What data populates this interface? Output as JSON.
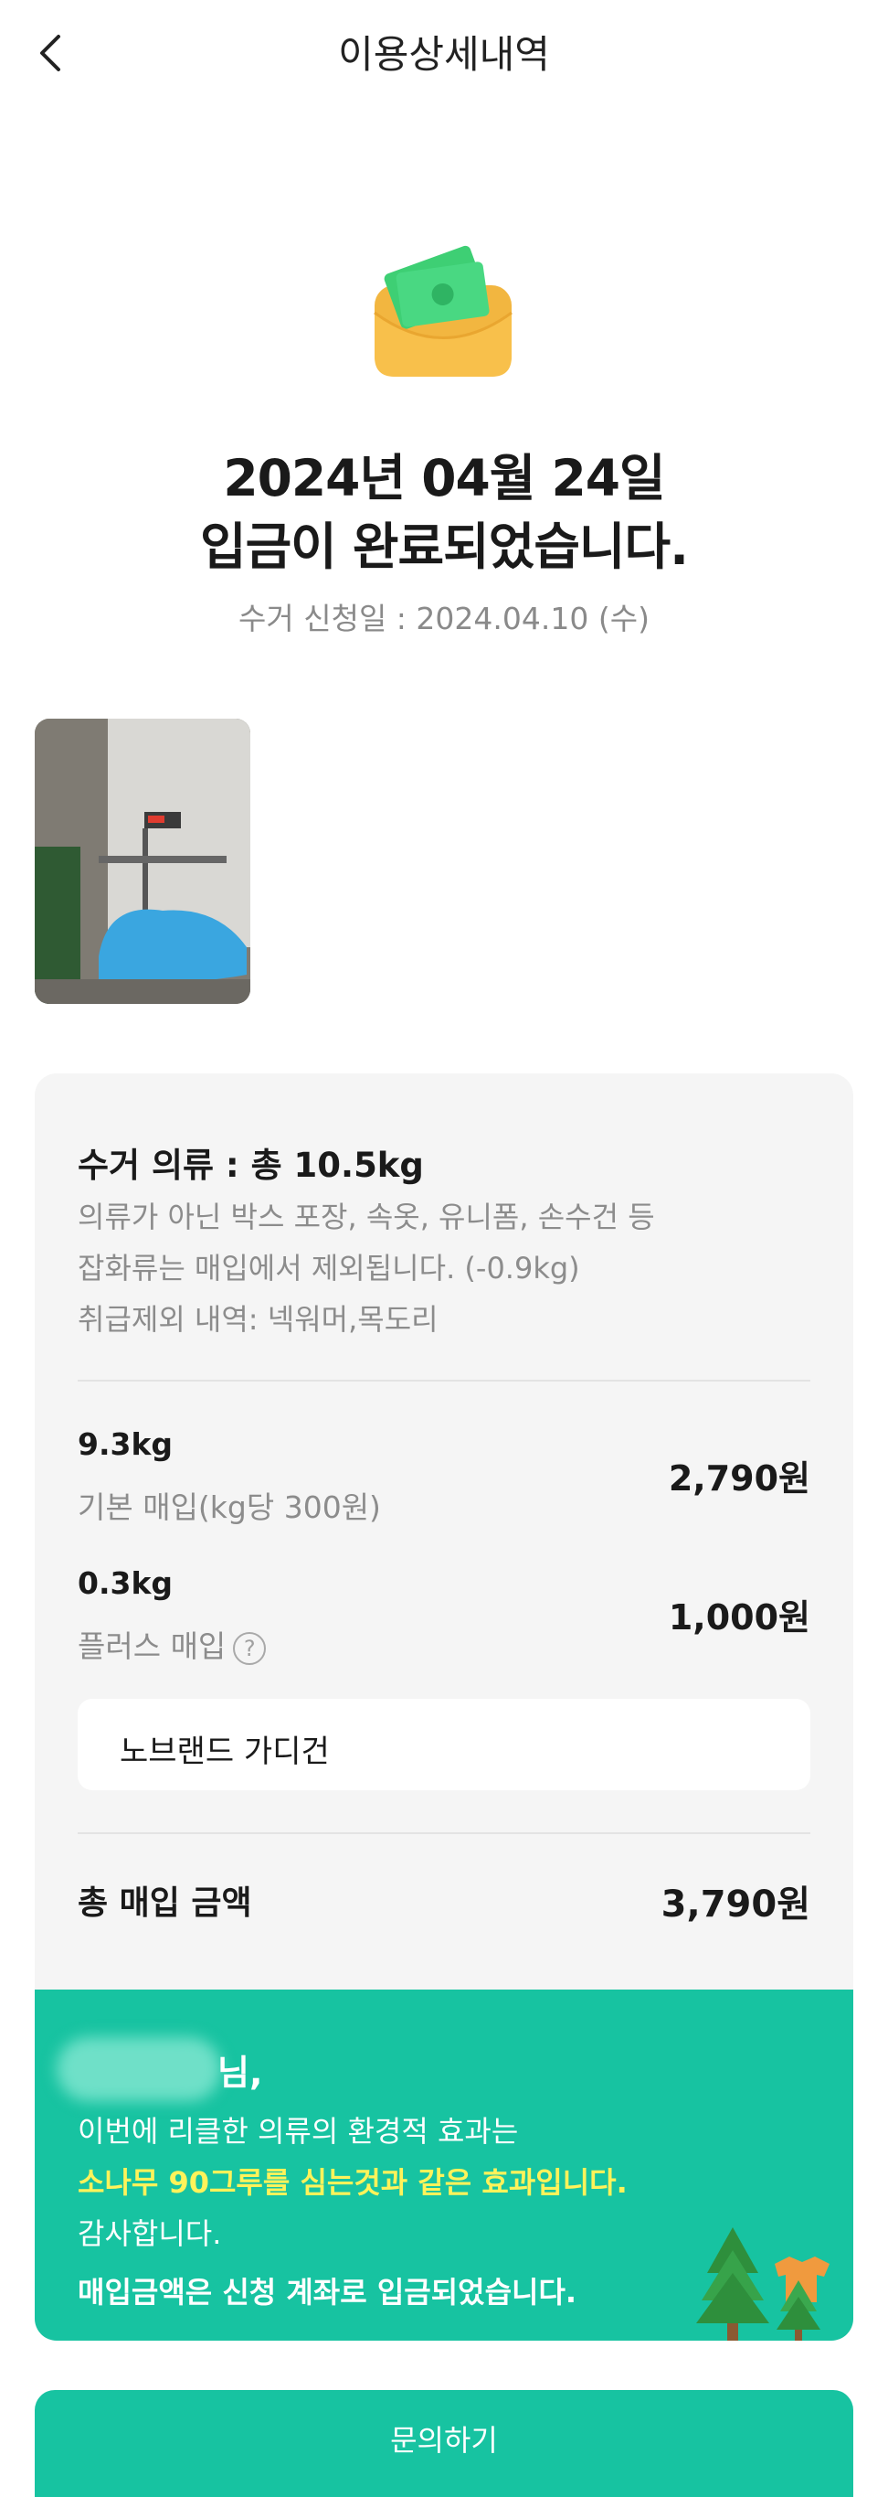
{
  "header": {
    "title": "이용상세내역"
  },
  "status": {
    "date_line": "2024년 04월 24일",
    "message_line": "입금이 완료되었습니다.",
    "apply_date": "수거 신청일 : 2024.04.10 (수)"
  },
  "collection": {
    "total": "수거 의류 : 총 10.5kg",
    "notes": [
      "의류가 아닌 박스 포장, 속옷, 유니폼, 손수건 등",
      "잡화류는 매입에서 제외됩니다. (-0.9kg)",
      "취급제외 내역: 넥워머,목도리"
    ]
  },
  "basic": {
    "weight": "9.3kg",
    "label": "기본 매입(kg당 300원)",
    "price": "2,790원"
  },
  "plus": {
    "weight": "0.3kg",
    "label": "플러스 매입",
    "help": "?",
    "price": "1,000원",
    "item": "노브랜드 가디건"
  },
  "summary": {
    "label": "총 매입 금액",
    "value": "3,790원"
  },
  "effect": {
    "name_suffix": "님,",
    "line1": "이번에 리클한 의류의 환경적 효과는",
    "line2": "소나무 90그루를 심는것과 같은 효과입니다.",
    "line3": "감사합니다.",
    "line4": "매입금액은 신청 계좌로 입금되었습니다."
  },
  "cta": {
    "label": "문의하기"
  },
  "colors": {
    "accent": "#17c3a1",
    "highlight": "#fff35a"
  },
  "icons": {
    "back": "chevron-left-icon",
    "wallet": "money-envelope-icon",
    "trees": "pine-trees-icon"
  }
}
